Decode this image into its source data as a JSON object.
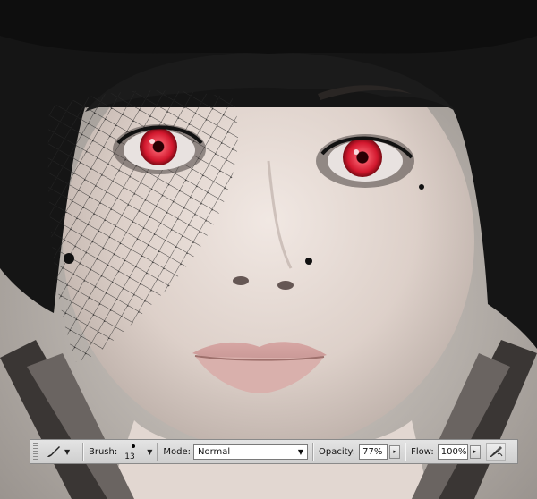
{
  "toolbar": {
    "tool_preset_icon": "brush-tool-icon",
    "brush_label": "Brush:",
    "brush_size": "13",
    "mode_label": "Mode:",
    "mode_value": "Normal",
    "opacity_label": "Opacity:",
    "opacity_value": "77%",
    "flow_label": "Flow:",
    "flow_value": "100%",
    "airbrush_icon": "airbrush-icon"
  },
  "colors": {
    "toolbar_bg": "#d9d9d9",
    "iris_red": "#d7263d",
    "hair": "#141414",
    "skin": "#e4d8d2"
  }
}
